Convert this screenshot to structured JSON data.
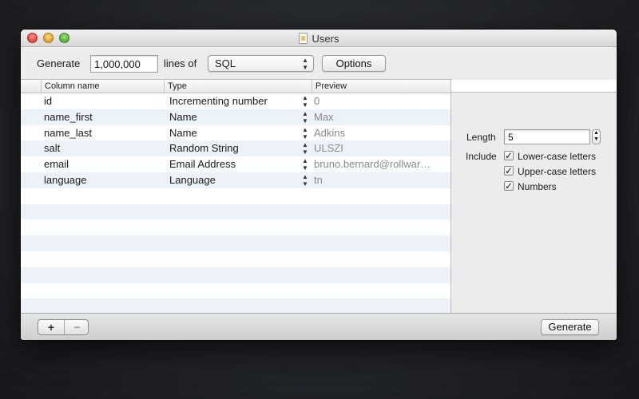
{
  "window": {
    "title": "Users",
    "doc_icon": "document-icon"
  },
  "toolbar": {
    "generate_label": "Generate",
    "count_value": "1,000,000",
    "lines_of_label": "lines of",
    "format_value": "SQL",
    "options_label": "Options"
  },
  "table": {
    "headers": [
      "Column name",
      "Type",
      "Preview"
    ],
    "rows": [
      {
        "name": "id",
        "type": "Incrementing number",
        "preview": "0"
      },
      {
        "name": "name_first",
        "type": "Name",
        "preview": "Max"
      },
      {
        "name": "name_last",
        "type": "Name",
        "preview": "Adkins"
      },
      {
        "name": "salt",
        "type": "Random String",
        "preview": "ULSZI"
      },
      {
        "name": "email",
        "type": "Email Address",
        "preview": "bruno.bernard@rollwar…"
      },
      {
        "name": "language",
        "type": "Language",
        "preview": "tn"
      }
    ]
  },
  "settings": {
    "length_label": "Length",
    "length_value": "5",
    "include_label": "Include",
    "checks": [
      {
        "label": "Lower-case letters",
        "checked": true
      },
      {
        "label": "Upper-case letters",
        "checked": true
      },
      {
        "label": "Numbers",
        "checked": true
      }
    ]
  },
  "bottom": {
    "add_symbol": "+",
    "remove_symbol": "−",
    "generate_label": "Generate"
  },
  "colors": {
    "row_stripe": "#edf2f9",
    "preview_text": "#8a8a8a"
  }
}
